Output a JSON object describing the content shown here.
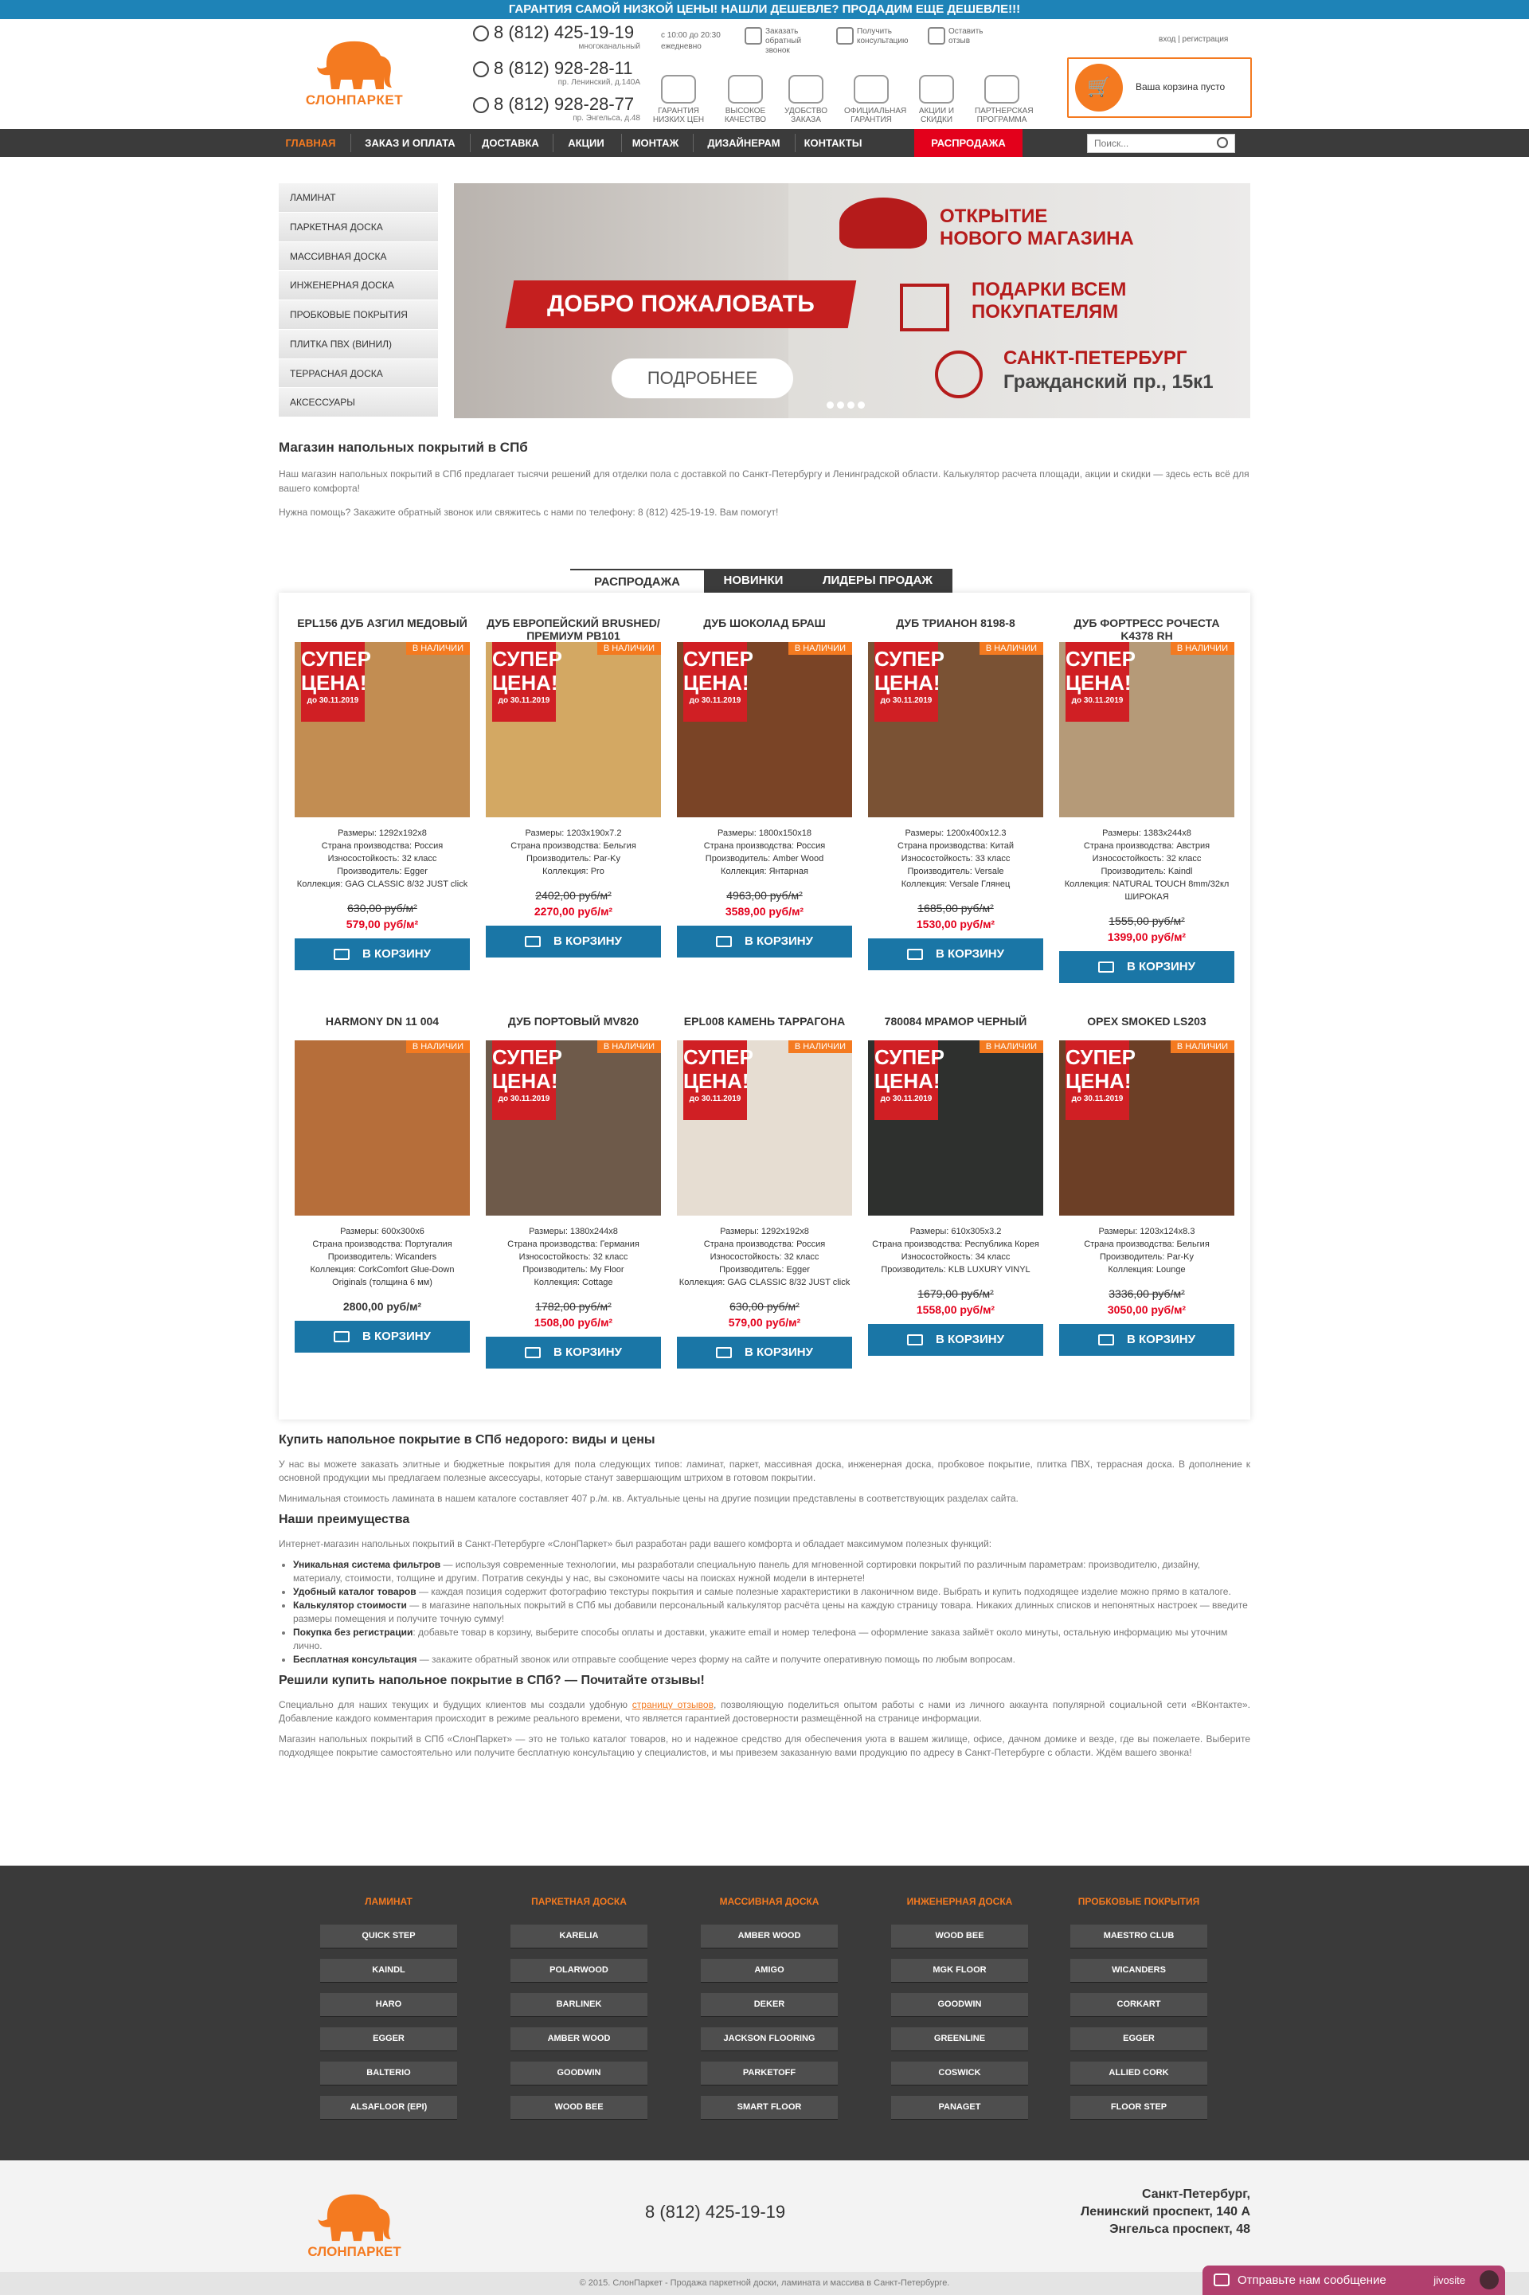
{
  "topbar": {
    "text": "ГАРАНТИЯ САМОЙ НИЗКОЙ ЦЕНЫ! НАШЛИ ДЕШЕВЛЕ? ПРОДАДИМ ЕЩЕ ДЕШЕВЛЕ!!!"
  },
  "brand": {
    "name": "СЛОНПАРКЕТ",
    "accent": "#f47a20",
    "blue": "#1a76a6",
    "sale_red": "#e3001b"
  },
  "header": {
    "phones": [
      {
        "number": "8 (812) 425-19-19",
        "note": "многоканальный"
      },
      {
        "number": "8 (812) 928-28-11",
        "note": "пр. Ленинский, д.140А"
      },
      {
        "number": "8 (812) 928-28-77",
        "note": "пр. Энгельса, д.48"
      }
    ],
    "hours": "с 10:00 до 20:30 ежедневно",
    "services": [
      "Заказать обратный звонок",
      "Получить консультацию",
      "Оставить отзыв"
    ],
    "login": "вход | регистрация",
    "features": [
      "ГАРАНТИЯ НИЗКИХ ЦЕН",
      "ВЫСОКОЕ КАЧЕСТВО",
      "УДОБСТВО ЗАКАЗА",
      "ОФИЦИАЛЬНАЯ ГАРАНТИЯ",
      "АКЦИИ И СКИДКИ",
      "ПАРТНЕРСКАЯ ПРОГРАММА"
    ],
    "cart": "Ваша корзина пусто"
  },
  "nav": {
    "items": [
      "ГЛАВНАЯ",
      "ЗАКАЗ И ОПЛАТА",
      "ДОСТАВКА",
      "АКЦИИ",
      "МОНТАЖ",
      "ДИЗАЙНЕРАМ",
      "КОНТАКТЫ"
    ],
    "sale": "РАСПРОДАЖА",
    "search_placeholder": "Поиск..."
  },
  "catmenu": [
    "ЛАМИНАТ",
    "ПАРКЕТНАЯ ДОСКА",
    "МАССИВНАЯ ДОСКА",
    "ИНЖЕНЕРНАЯ ДОСКА",
    "ПРОБКОВЫЕ ПОКРЫТИЯ",
    "ПЛИТКА ПВХ (ВИНИЛ)",
    "ТЕРРАСНАЯ ДОСКА",
    "АКСЕССУАРЫ"
  ],
  "banner": {
    "welcome": "ДОБРО ПОЖАЛОВАТЬ",
    "button": "ПОДРОБНЕЕ",
    "line1a": "ОТКРЫТИЕ",
    "line1b": "НОВОГО МАГАЗИНА",
    "line2a": "ПОДАРКИ ВСЕМ",
    "line2b": "ПОКУПАТЕЛЯМ",
    "line3a": "САНКТ-ПЕТЕРБУРГ",
    "line3b": "Гражданский пр., 15к1"
  },
  "intro": {
    "title": "Магазин напольных покрытий в СПб",
    "p1": "Наш магазин напольных покрытий в СПб предлагает тысячи решений для отделки пола с доставкой по Санкт-Петербургу и Ленинградской области. Калькулятор расчета площади, акции и скидки — здесь есть всё для вашего комфорта!",
    "p2": "Нужна помощь? Закажите обратный звонок или свяжитесь с нами по телефону: 8 (812) 425-19-19. Вам помогут!"
  },
  "tabs": [
    "РАСПРОДАЖА",
    "НОВИНКИ",
    "ЛИДЕРЫ ПРОДАЖ"
  ],
  "product_common": {
    "in_stock": "В НАЛИЧИИ",
    "super1": "СУПЕР",
    "super2": "ЦЕНА!",
    "until": "до 30.11.2019",
    "buy": "В КОРЗИНУ"
  },
  "products": [
    {
      "title": "EPL156 ДУБ АЗГИЛ МЕДОВЫЙ",
      "specs": [
        "Размеры: 1292x192x8",
        "Страна производства: Россия",
        "Износостойкость: 32 класс",
        "Производитель: Egger",
        "Коллекция: GAG CLASSIC 8/32 JUST click"
      ],
      "old": "630,00 руб/м²",
      "price": "579,00 руб/м²",
      "color": "#c28d52",
      "super": true
    },
    {
      "title": "ДУБ ЕВРОПЕЙСКИЙ BRUSHED/ПРЕМИУМ PB101",
      "specs": [
        "Размеры: 1203x190x7.2",
        "Страна производства: Бельгия",
        "Производитель: Par-Ky",
        "Коллекция: Pro"
      ],
      "old": "2402,00 руб/м²",
      "price": "2270,00 руб/м²",
      "color": "#d3a863",
      "super": true
    },
    {
      "title": "ДУБ ШОКОЛАД БРАШ",
      "specs": [
        "Размеры: 1800x150x18",
        "Страна производства: Россия",
        "Производитель: Amber Wood",
        "Коллекция: Янтарная"
      ],
      "old": "4963,00 руб/м²",
      "price": "3589,00 руб/м²",
      "color": "#7a4426",
      "super": true
    },
    {
      "title": "ДУБ ТРИАНОН 8198-8",
      "specs": [
        "Размеры: 1200x400x12.3",
        "Страна производства: Китай",
        "Износостойкость: 33 класс",
        "Производитель: Versale",
        "Коллекция: Versale Глянец"
      ],
      "old": "1685,00 руб/м²",
      "price": "1530,00 руб/м²",
      "color": "#7a5234",
      "super": true
    },
    {
      "title": "ДУБ ФОРТРЕСС РОЧЕСТА K4378 RH",
      "specs": [
        "Размеры: 1383x244x8",
        "Страна производства: Австрия",
        "Износостойкость: 32 класс",
        "Производитель: Kaindl",
        "Коллекция: NATURAL TOUCH 8mm/32кл ШИРОКАЯ"
      ],
      "old": "1555,00 руб/м²",
      "price": "1399,00 руб/м²",
      "color": "#b59a78",
      "super": true
    },
    {
      "title": "HARMONY DN 11 004",
      "specs": [
        "Размеры: 600x300x6",
        "Страна производства: Португалия",
        "Производитель: Wicanders",
        "Коллекция: CorkComfort Glue-Down Originals (толщина 6 мм)"
      ],
      "old": "",
      "price": "2800,00 руб/м²",
      "color": "#b66e3a",
      "super": false
    },
    {
      "title": "ДУБ ПОРТОВЫЙ MV820",
      "specs": [
        "Размеры: 1380x244x8",
        "Страна производства: Германия",
        "Износостойкость: 32 класс",
        "Производитель: My Floor",
        "Коллекция: Cottage"
      ],
      "old": "1782,00 руб/м²",
      "price": "1508,00 руб/м²",
      "color": "#6e5a4a",
      "super": true
    },
    {
      "title": "EPL008 КАМЕНЬ ТАРРАГОНА",
      "specs": [
        "Размеры: 1292x192x8",
        "Страна производства: Россия",
        "Износостойкость: 32 класс",
        "Производитель: Egger",
        "Коллекция: GAG CLASSIC 8/32 JUST click"
      ],
      "old": "630,00 руб/м²",
      "price": "579,00 руб/м²",
      "color": "#e6ddd2",
      "super": true
    },
    {
      "title": "780084 МРАМОР ЧЕРНЫЙ",
      "specs": [
        "Размеры: 610x305x3.2",
        "Страна производства: Республика Корея",
        "Износостойкость: 34 класс",
        "Производитель: KLB LUXURY VINYL"
      ],
      "old": "1679,00 руб/м²",
      "price": "1558,00 руб/м²",
      "color": "#2e302e",
      "super": true
    },
    {
      "title": "OPEX SMOKED LS203",
      "specs": [
        "Размеры: 1203x124x8.3",
        "Страна производства: Бельгия",
        "Производитель: Par-Ky",
        "Коллекция: Lounge"
      ],
      "old": "3336,00 руб/м²",
      "price": "3050,00 руб/м²",
      "color": "#6c3f26",
      "super": true
    }
  ],
  "seo": {
    "h1": "Купить напольное покрытие в СПб недорого: виды и цены",
    "p1": "У нас вы можете заказать элитные и бюджетные покрытия для пола следующих типов: ламинат, паркет, массивная доска, инженерная доска, пробковое покрытие, плитка ПВХ, террасная доска. В дополнение к основной продукции мы предлагаем полезные аксессуары, которые станут завершающим штрихом в готовом покрытии.",
    "p2": "Минимальная стоимость ламината в нашем каталоге составляет 407 р./м. кв. Актуальные цены на другие позиции представлены в соответствующих разделах сайта.",
    "h2": "Наши преимущества",
    "p3": "Интернет-магазин напольных покрытий в Санкт-Петербурге «СлонПаркет» был разработан ради вашего комфорта и обладает максимумом полезных функций:",
    "list": [
      {
        "b": "Уникальная система фильтров",
        "t": " — используя современные технологии, мы разработали специальную панель для мгновенной сортировки покрытий по различным параметрам: производителю, дизайну, материалу, стоимости, толщине и другим. Потратив секунды у нас, вы сэкономите часы на поисках нужной модели в интернете!"
      },
      {
        "b": "Удобный каталог товаров",
        "t": " — каждая позиция содержит фотографию текстуры покрытия и самые полезные характеристики в лаконичном виде. Выбрать и купить подходящее изделие можно прямо в каталоге."
      },
      {
        "b": "Калькулятор стоимости",
        "t": " — в магазине напольных покрытий в СПб мы добавили персональный калькулятор расчёта цены на каждую страницу товара. Никаких длинных списков и непонятных настроек — введите размеры помещения и получите точную сумму!"
      },
      {
        "b": "Покупка без регистрации",
        "t": ": добавьте товар в корзину, выберите способы оплаты и доставки, укажите email и номер телефона — оформление заказа займёт около минуты, остальную информацию мы уточним лично."
      },
      {
        "b": "Бесплатная консультация",
        "t": " — закажите обратный звонок или отправьте сообщение через форму на сайте и получите оперативную помощь по любым вопросам."
      }
    ],
    "h3": "Решили купить напольное покрытие в СПб? — Почитайте отзывы!",
    "p4a": "Специально для наших текущих и будущих клиентов мы создали удобную ",
    "p4link": "страницу отзывов",
    "p4b": ", позволяющую поделиться опытом работы с нами из личного аккаунта популярной социальной сети «ВКонтакте». Добавление каждого комментария происходит в режиме реального времени, что является гарантией достоверности размещённой на странице информации.",
    "p5": "Магазин напольных покрытий в СПб «СлонПаркет» — это не только каталог товаров, но и надежное средство для обеспечения уюта в вашем жилище, офисе, дачном домике и везде, где вы пожелаете. Выберите подходящее покрытие самостоятельно или получите бесплатную консультацию у специалистов, и мы привезем заказанную вами продукцию по адресу в Санкт-Петербурге с области. Ждём вашего звонка!"
  },
  "brands": [
    {
      "head": "ЛАМИНАТ",
      "items": [
        "QUICK STEP",
        "KAINDL",
        "HARO",
        "EGGER",
        "BALTERIO",
        "ALSAFLOOR (EPI)"
      ]
    },
    {
      "head": "ПАРКЕТНАЯ ДОСКА",
      "items": [
        "KARELIA",
        "POLARWOOD",
        "BARLINEK",
        "AMBER WOOD",
        "GOODWIN",
        "WOOD BEE"
      ]
    },
    {
      "head": "МАССИВНАЯ ДОСКА",
      "items": [
        "AMBER WOOD",
        "AMIGO",
        "DEKER",
        "JACKSON FLOORING",
        "PARKETOFF",
        "SMART FLOOR"
      ]
    },
    {
      "head": "ИНЖЕНЕРНАЯ ДОСКА",
      "items": [
        "WOOD BEE",
        "MGK FLOOR",
        "GOODWIN",
        "GREENLINE",
        "COSWICK",
        "PANAGET"
      ]
    },
    {
      "head": "ПРОБКОВЫЕ ПОКРЫТИЯ",
      "items": [
        "MAESTRO CLUB",
        "WICANDERS",
        "CORKART",
        "EGGER",
        "ALLIED CORK",
        "FLOOR STEP"
      ]
    }
  ],
  "footer": {
    "phone": "8 (812) 425-19-19",
    "addr1": "Санкт-Петербург,",
    "addr2": "Ленинский проспект, 140 А",
    "addr3": "Энгельса проспект, 48",
    "copyright": "© 2015. СлонПаркет - Продажа паркетной доски, ламината и массива в Санкт-Петербурге."
  },
  "chat": {
    "label": "Отправьте нам сообщение",
    "brand": "jivosite"
  }
}
